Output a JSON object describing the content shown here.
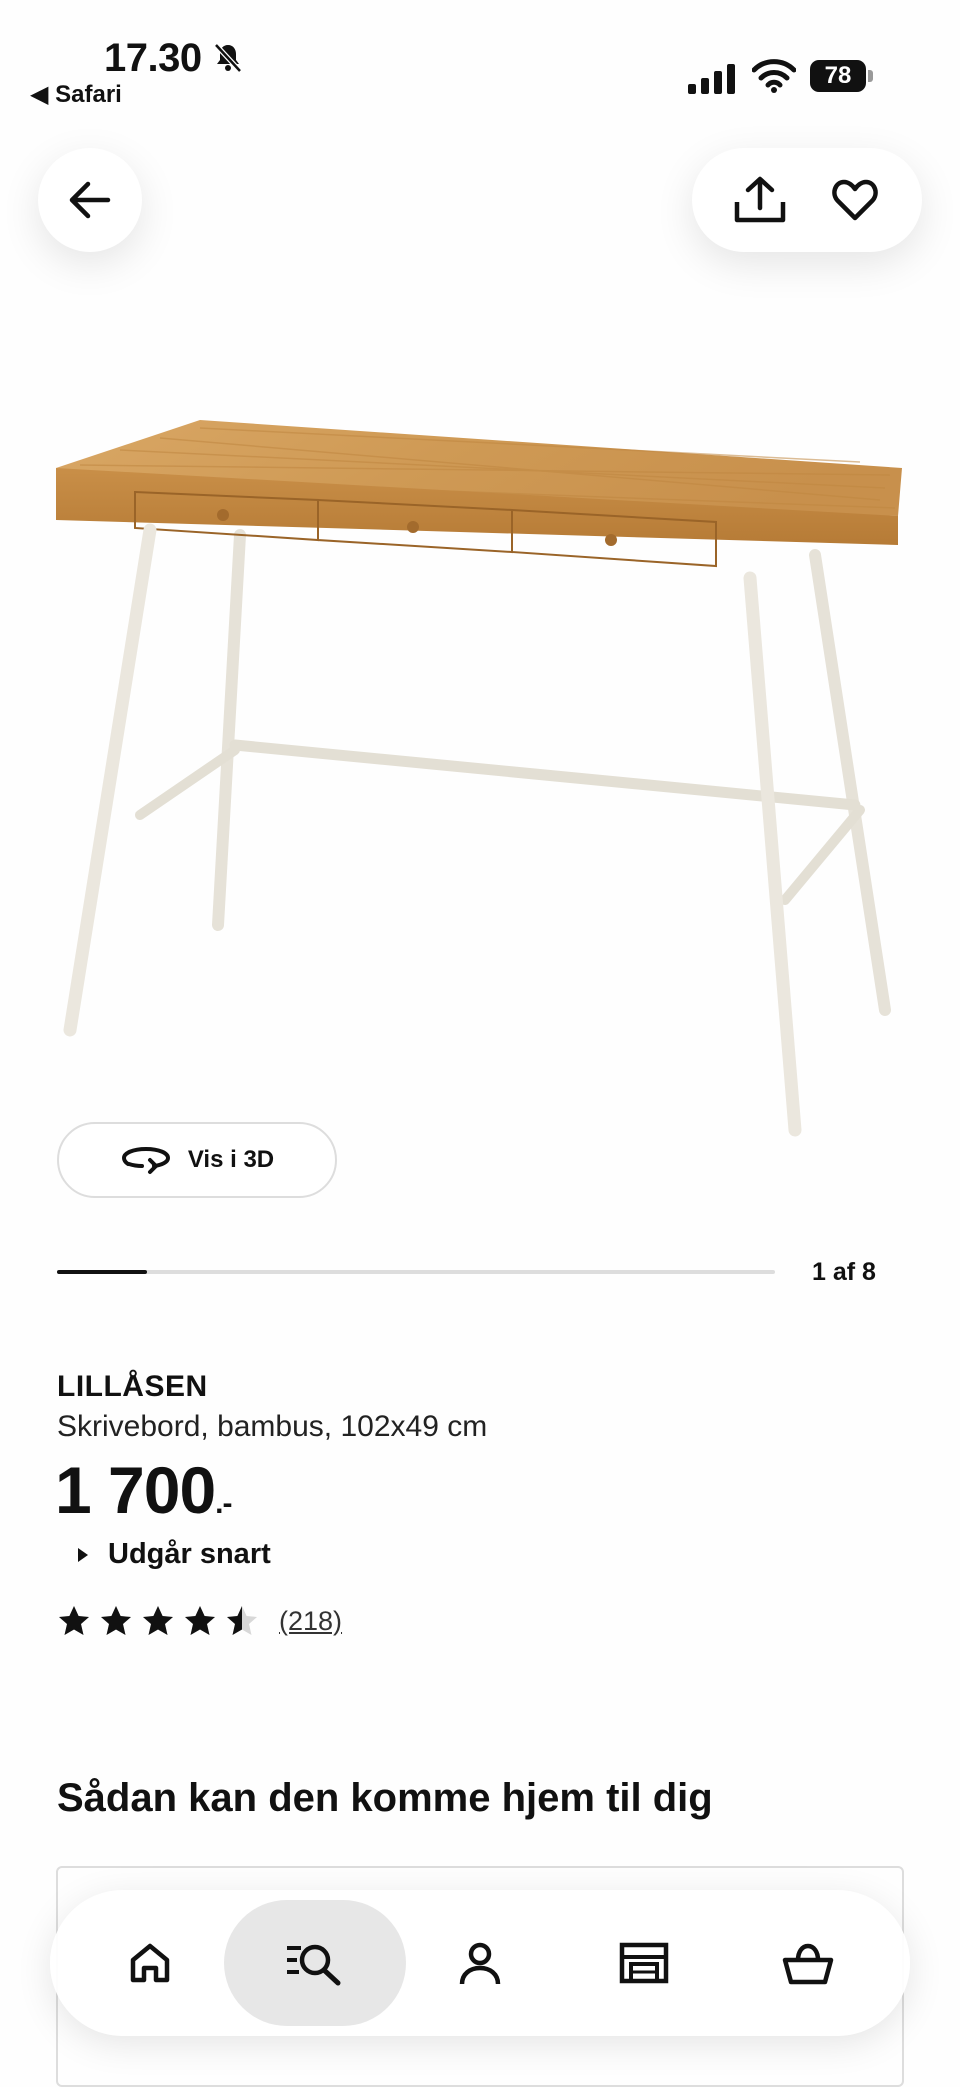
{
  "status_bar": {
    "time": "17.30",
    "back_app": "◀ Safari",
    "battery": "78"
  },
  "icons": {
    "back": "arrow-left-icon",
    "share": "share-icon",
    "favorite": "heart-icon",
    "view3d": "rotate-icon"
  },
  "gallery": {
    "view3d_label": "Vis i 3D",
    "page_count": "1 af 8",
    "current_page": 1,
    "total_pages": 8
  },
  "product": {
    "name": "LILLÅSEN",
    "description": "Skrivebord, bambus, 102x49 cm",
    "price": "1 700",
    "price_suffix": ".-",
    "availability": "Udgår snart",
    "rating": 4.5,
    "reviews": "(218)"
  },
  "delivery": {
    "title": "Sådan kan den komme hjem til dig"
  },
  "nav": {
    "items": [
      "home-icon",
      "search-icon",
      "profile-icon",
      "store-icon",
      "basket-icon"
    ],
    "active": "search-icon"
  }
}
